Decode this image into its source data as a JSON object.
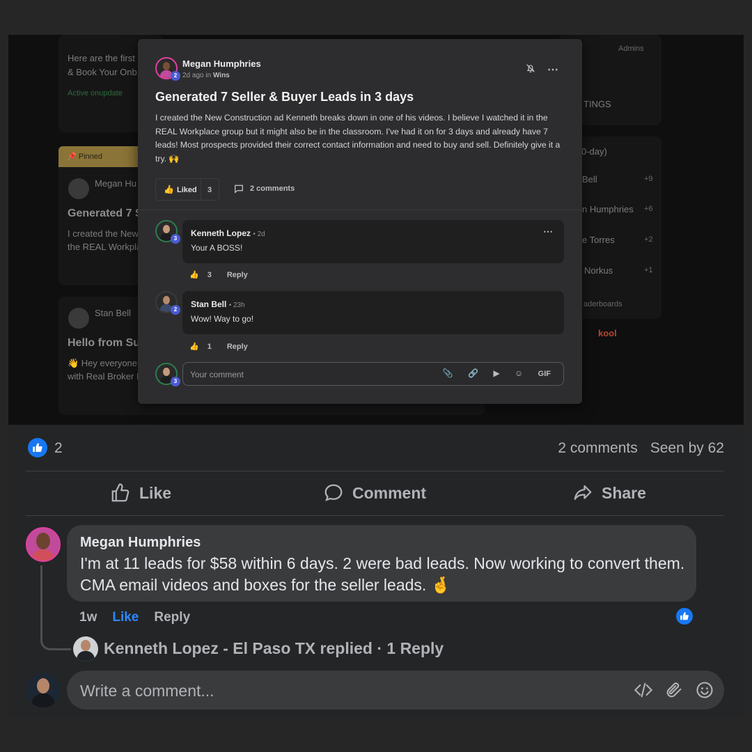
{
  "background_page": {
    "card1_line1": "Here are the first",
    "card1_line2": "& Book Your Onb",
    "card1_link": "Active onupdate",
    "pinned_label": "Pinned",
    "pinned_author": "Megan Hu",
    "pinned_title": "Generated 7 S",
    "pinned_line1": "I created the New",
    "pinned_line2": "the REAL Workpla",
    "post3_author": "Stan Bell",
    "post3_title": "Hello from Su",
    "post3_line1": "👋 Hey everyone,",
    "post3_line2": "with Real Broker L",
    "right_tab": "Admins",
    "right_settings": "TINGS",
    "right_leaderboard_title": "0-day)",
    "right_rows": [
      {
        "name": "Bell",
        "points": "+9"
      },
      {
        "name": "n Humphries",
        "points": "+6"
      },
      {
        "name": "e Torres",
        "points": "+2"
      },
      {
        "name": "Norkus",
        "points": "+1"
      }
    ],
    "right_link": "aderboards",
    "kool": "kool"
  },
  "modal": {
    "author": "Megan Humphries",
    "author_level": "2",
    "meta_time": "2d ago in",
    "meta_category": "Wins",
    "title": "Generated 7 Seller & Buyer Leads in 3 days",
    "body": "I created the New Construction ad Kenneth breaks down in one of his videos. I believe I watched it in the REAL Workplace group but it might also be in the classroom. I've had it on for 3 days and already have 7 leads! Most prospects provided their correct contact information and need to buy and sell. Definitely give it a try. 🙌",
    "liked_label": "Liked",
    "liked_count": "3",
    "comments_label": "2 comments",
    "comments": [
      {
        "author": "Kenneth Lopez",
        "time": "• 2d",
        "level": "3",
        "text": "Your A BOSS!",
        "likes": "3",
        "reply": "Reply"
      },
      {
        "author": "Stan Bell",
        "time": "• 23h",
        "level": "2",
        "text": "Wow! Way to go!",
        "likes": "1",
        "reply": "Reply"
      }
    ],
    "input_placeholder": "Your comment",
    "input_level": "3",
    "gif_label": "GIF"
  },
  "facebook": {
    "reaction_count": "2",
    "comments_count": "2 comments",
    "seen_by": "Seen by 62",
    "like_label": "Like",
    "comment_label": "Comment",
    "share_label": "Share",
    "comment": {
      "author": "Megan Humphries",
      "text": "I'm at 11 leads for $58 within 6 days. 2 were bad leads. Now working to convert them. CMA email videos and boxes for the seller leads. 🤞",
      "time": "1w",
      "like": "Like",
      "reply": "Reply"
    },
    "reply_summary": "Kenneth Lopez - El Paso TX replied · 1 Reply",
    "write_placeholder": "Write a comment..."
  },
  "colors": {
    "fb_blue": "#1877f2",
    "fb_link_blue": "#2d88ff",
    "level_badge": "#4a5bd4",
    "pinned": "#8a7437"
  }
}
